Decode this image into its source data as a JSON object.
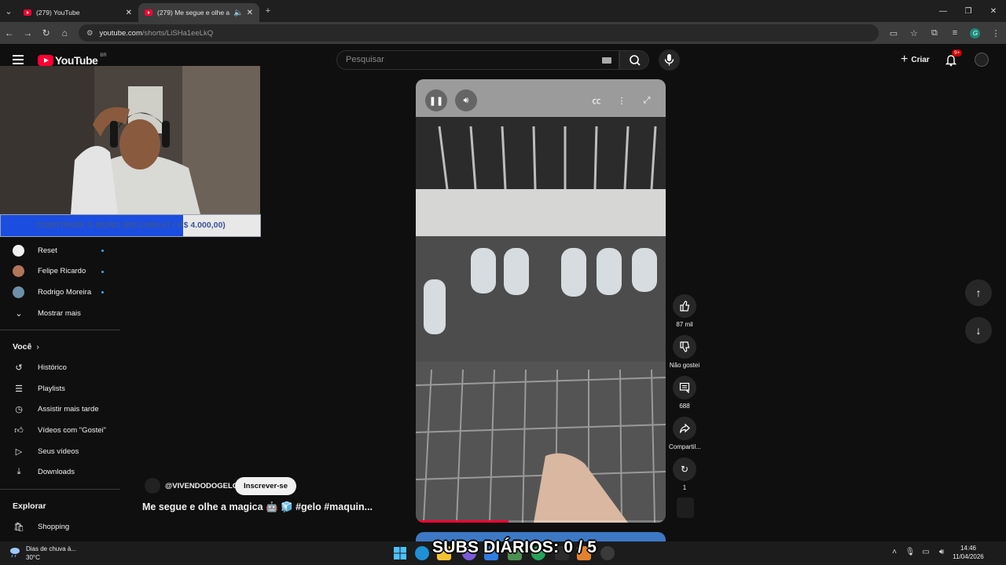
{
  "browser": {
    "tabs": [
      {
        "title": "(279) YouTube",
        "active": false
      },
      {
        "title": "(279) Me segue e olhe a ma",
        "active": true
      }
    ],
    "url_host": "youtube.com",
    "url_path": "/shorts/LiSHa1eeLkQ"
  },
  "header": {
    "logo_text": "YouTube",
    "country": "BR",
    "search_placeholder": "Pesquisar",
    "create_label": "Criar",
    "notification_count": "9+"
  },
  "stream_overlay": {
    "goal_label": "CONSTRUIR O MURO (R$ 2.809,67 / R$ 4.000,00)",
    "goal_current": 2809.67,
    "goal_total": 4000.0,
    "subs_label": "SUBS DIÁRIOS: 0 / 5"
  },
  "sidebar": {
    "subscriptions": [
      {
        "label": "Reset",
        "new": true
      },
      {
        "label": "Felipe Ricardo",
        "new": true
      },
      {
        "label": "Rodrigo Moreira",
        "new": true
      }
    ],
    "show_more": "Mostrar mais",
    "you_heading": "Você",
    "you_items": [
      {
        "label": "Histórico",
        "icon": "history-icon"
      },
      {
        "label": "Playlists",
        "icon": "playlist-icon"
      },
      {
        "label": "Assistir mais tarde",
        "icon": "clock-icon"
      },
      {
        "label": "Vídeos com \"Gostei\"",
        "icon": "thumb-up-icon"
      },
      {
        "label": "Seus vídeos",
        "icon": "video-icon"
      },
      {
        "label": "Downloads",
        "icon": "download-icon"
      }
    ],
    "explore_heading": "Explorar",
    "explore_items": [
      {
        "label": "Shopping",
        "icon": "shopping-bag-icon"
      }
    ]
  },
  "short": {
    "channel": "@VIVENDODOGELO",
    "subscribe_label": "Inscrever-se",
    "title": "Me segue e olhe a magica 🤖 🧊 #gelo #maquin...",
    "progress": 0.37
  },
  "actions": {
    "likes": "87 mil",
    "dislike_label": "Não gostei",
    "comments": "688",
    "share_label": "Compartil...",
    "remix_count": "1"
  },
  "taskbar": {
    "weather_title": "Dias de chuva à...",
    "weather_temp": "30°C",
    "time": "14:46",
    "date": "11/04/2026"
  },
  "colors": {
    "youtube_red": "#ff0033",
    "goal_fill": "#1b4de0",
    "link_blue": "#3ea6ff"
  }
}
